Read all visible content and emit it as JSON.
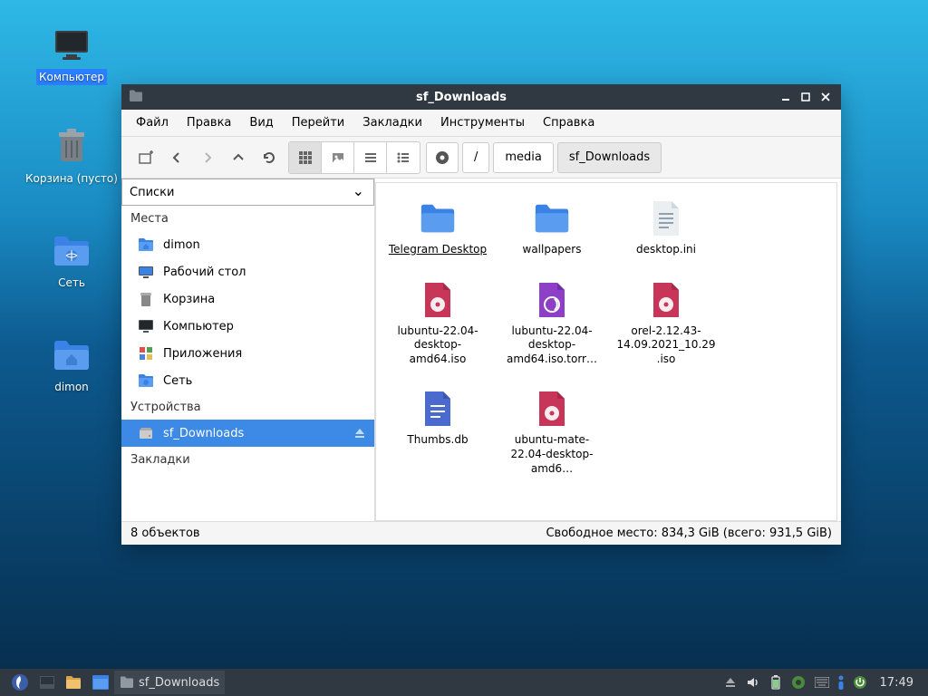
{
  "desktop_icons": [
    {
      "label": "Компьютер",
      "name": "computer",
      "icon": "monitor",
      "selected": true
    },
    {
      "label": "Корзина (пусто)",
      "name": "trash",
      "icon": "trash"
    },
    {
      "label": "Сеть",
      "name": "network",
      "icon": "network-folder"
    },
    {
      "label": "dimon",
      "name": "home",
      "icon": "home-folder"
    }
  ],
  "window": {
    "title": "sf_Downloads",
    "menu": [
      "Файл",
      "Правка",
      "Вид",
      "Перейти",
      "Закладки",
      "Инструменты",
      "Справка"
    ],
    "path": [
      {
        "label": "/",
        "icon": true
      },
      {
        "label": "media"
      },
      {
        "label": "sf_Downloads",
        "active": true
      }
    ],
    "listsel": "Списки",
    "sections": {
      "places_title": "Места",
      "places": [
        {
          "label": "dimon",
          "icon": "home-folder"
        },
        {
          "label": "Рабочий стол",
          "icon": "desktop"
        },
        {
          "label": "Корзина",
          "icon": "trash"
        },
        {
          "label": "Компьютер",
          "icon": "monitor"
        },
        {
          "label": "Приложения",
          "icon": "apps"
        },
        {
          "label": "Сеть",
          "icon": "network-folder"
        }
      ],
      "devices_title": "Устройства",
      "devices": [
        {
          "label": "sf_Downloads",
          "icon": "disk",
          "selected": true,
          "eject": true
        }
      ],
      "bookmarks_title": "Закладки"
    },
    "files": [
      {
        "name": "Telegram Desktop",
        "type": "folder",
        "underline": true
      },
      {
        "name": "wallpapers",
        "type": "folder"
      },
      {
        "name": "desktop.ini",
        "type": "text"
      },
      {
        "name": "lubuntu-22.04-desktop-amd64.iso",
        "type": "iso"
      },
      {
        "name": "lubuntu-22.04-desktop-amd64.iso.torr…",
        "type": "torrent"
      },
      {
        "name": "orel-2.12.43-14.09.2021_10.29.iso",
        "type": "iso"
      },
      {
        "name": "Thumbs.db",
        "type": "doc"
      },
      {
        "name": "ubuntu-mate-22.04-desktop-amd6…",
        "type": "iso"
      }
    ],
    "status_left": "8 объектов",
    "status_right": "Свободное место: 834,3 GiB (всего: 931,5 GiB)"
  },
  "taskbar": {
    "task": "sf_Downloads",
    "clock": "17:49"
  }
}
